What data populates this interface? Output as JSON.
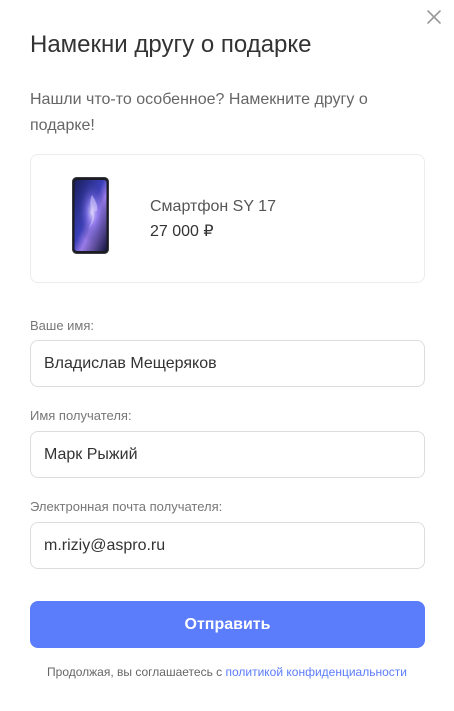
{
  "modal": {
    "title": "Намекни другу о подарке",
    "subtitle": "Нашли что-то особенное? Намекните другу о подарке!"
  },
  "product": {
    "name": "Смартфон SY 17",
    "price": "27 000 ₽",
    "image_icon": "smartphone-image"
  },
  "form": {
    "sender_name": {
      "label": "Ваше имя:",
      "value": "Владислав Мещеряков"
    },
    "recipient_name": {
      "label": "Имя получателя:",
      "value": "Марк Рыжий"
    },
    "recipient_email": {
      "label": "Электронная почта получателя:",
      "value": "m.riziy@aspro.ru"
    },
    "submit_label": "Отправить"
  },
  "consent": {
    "text": "Продолжая, вы соглашаетесь с ",
    "link_text": "политикой конфиденциальности"
  },
  "colors": {
    "accent": "#5b7cfb",
    "text": "#333333",
    "muted": "#777777",
    "border": "#dddddd"
  }
}
